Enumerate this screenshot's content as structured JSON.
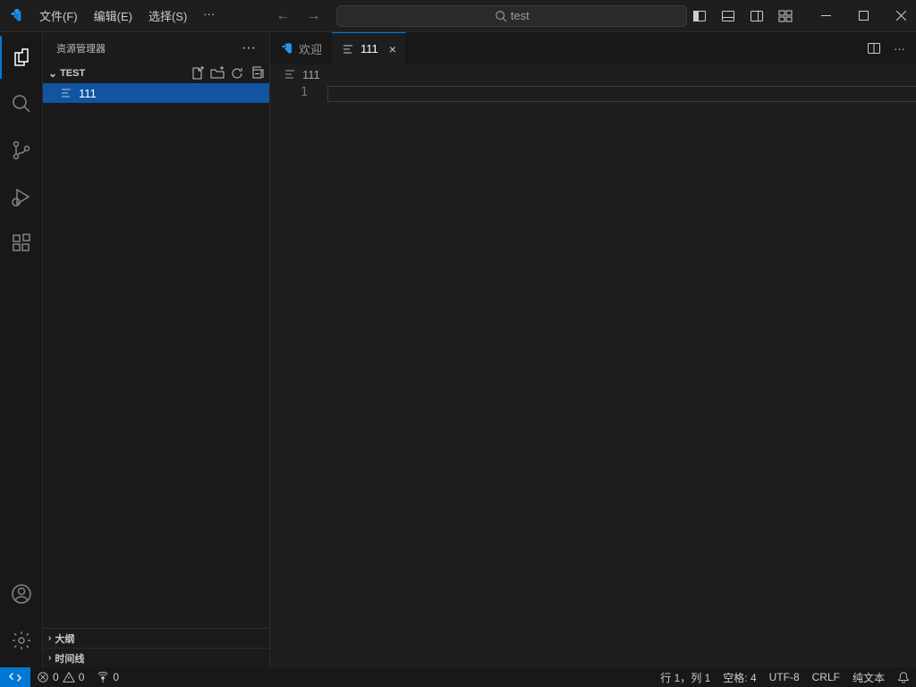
{
  "titlebar": {
    "menus": [
      "文件(F)",
      "编辑(E)",
      "选择(S)"
    ],
    "menu_more": "···",
    "search": "test"
  },
  "sidebar": {
    "title": "资源管理器",
    "more": "···",
    "folder": "TEST",
    "file": "111",
    "sections": [
      "大纲",
      "时间线"
    ]
  },
  "tabs": {
    "welcome": "欢迎",
    "file": "111"
  },
  "breadcrumb": {
    "file": "111"
  },
  "editor": {
    "line_number": "1"
  },
  "statusbar": {
    "errors": "0",
    "warnings": "0",
    "ports": "0",
    "cursor": "行 1，列 1",
    "spaces": "空格: 4",
    "encoding": "UTF-8",
    "eol": "CRLF",
    "language": "纯文本"
  }
}
